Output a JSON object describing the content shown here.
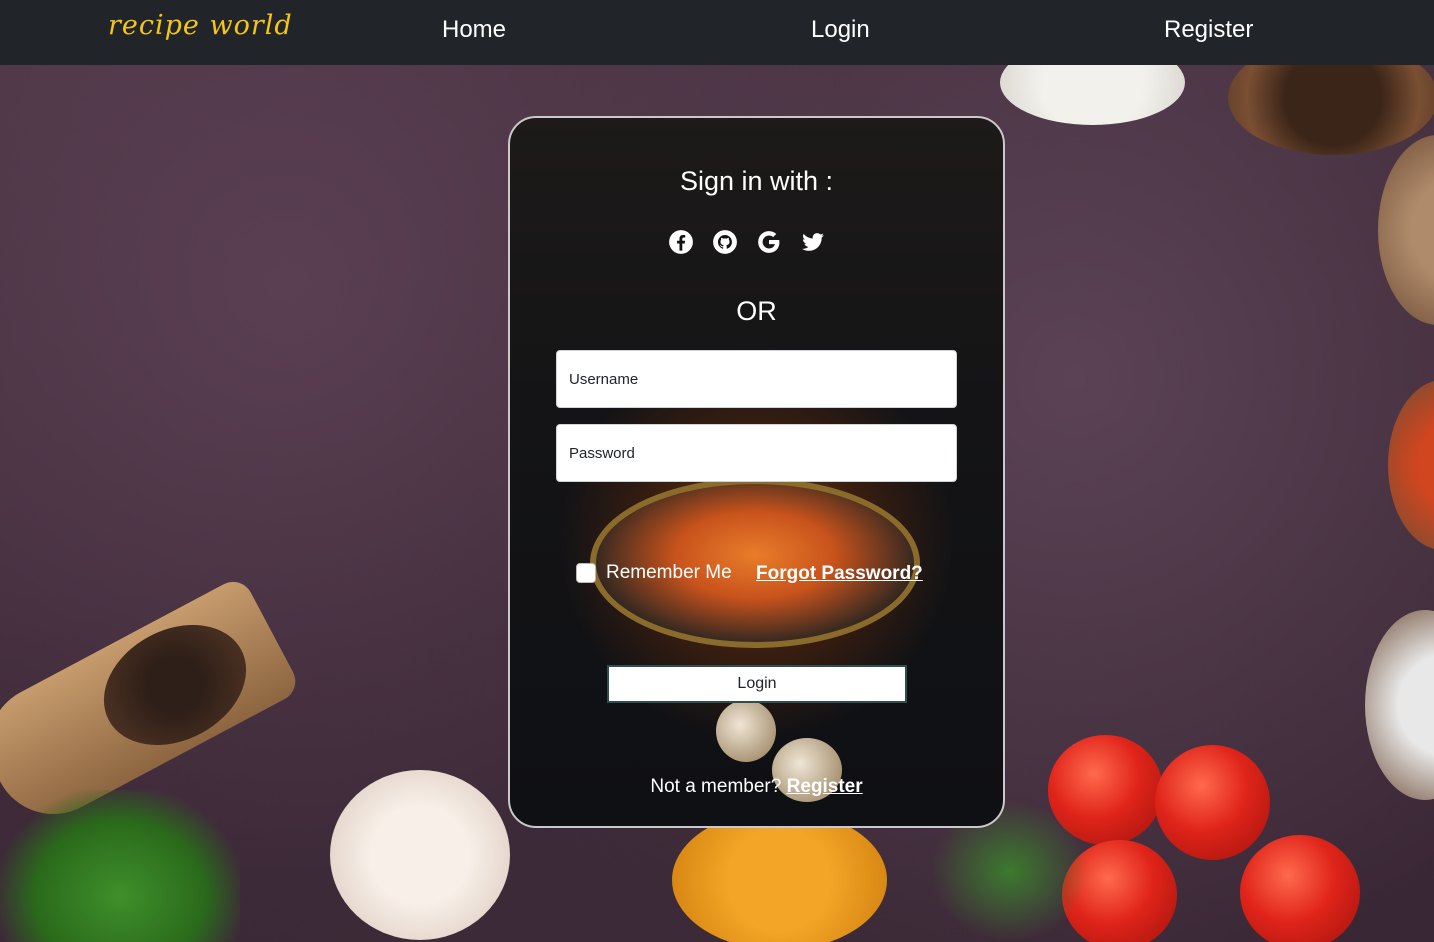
{
  "navbar": {
    "brand": "recipe world",
    "links": [
      "Home",
      "Login",
      "Register"
    ]
  },
  "login": {
    "title": "Sign in with :",
    "social_icons": [
      "facebook-icon",
      "github-icon",
      "google-icon",
      "twitter-icon"
    ],
    "or_text": "OR",
    "username_placeholder": "Username",
    "password_placeholder": "Password",
    "remember_label": "Remember Me",
    "forgot_label": "Forgot Password?",
    "login_button": "Login",
    "not_member_text": "Not a member? ",
    "register_link": "Register"
  },
  "colors": {
    "navbar_bg": "#212529",
    "brand": "#f5c518",
    "text": "#ffffff"
  }
}
